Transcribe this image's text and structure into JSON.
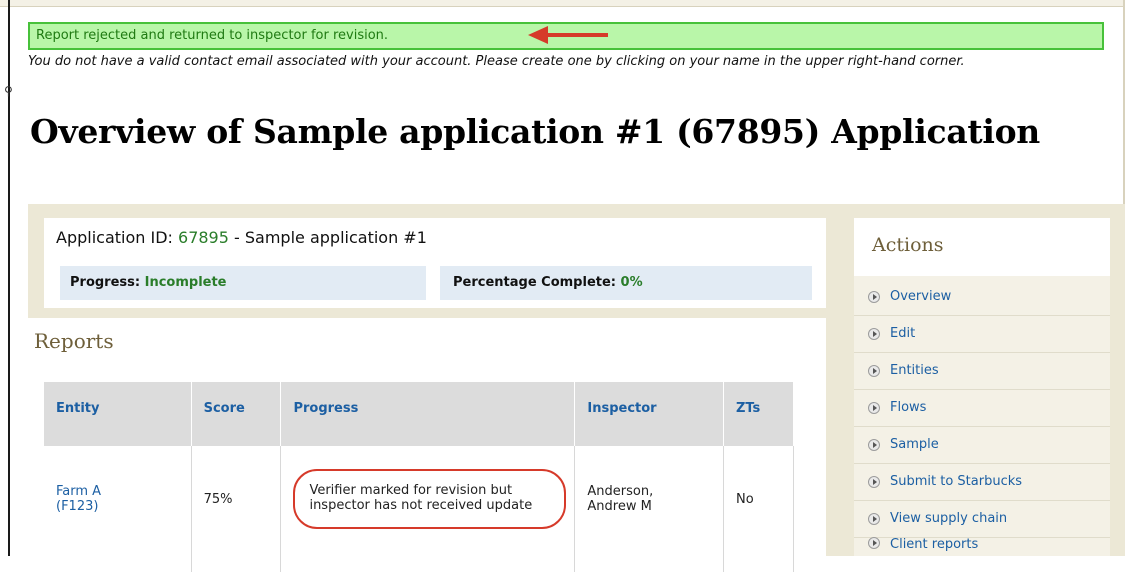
{
  "alert": {
    "message": "Report rejected and returned to inspector for revision."
  },
  "notice": {
    "text": "You do not have a valid contact email associated with your account. Please create one by clicking on your name in the upper right-hand corner."
  },
  "page": {
    "title": "Overview of Sample application #1 (67895) Application"
  },
  "application": {
    "id_label": "Application ID:",
    "id_value": "67895",
    "name": "- Sample application #1",
    "progress_label": "Progress:",
    "progress_value": "Incomplete",
    "percent_label": "Percentage Complete:",
    "percent_value": "0%"
  },
  "reports": {
    "heading": "Reports",
    "columns": [
      "Entity",
      "Score",
      "Progress",
      "Inspector",
      "ZTs"
    ],
    "rows": [
      {
        "entity_name": "Farm A",
        "entity_code": "(F123)",
        "score": "75%",
        "progress": "Verifier marked for revision but inspector has not received update",
        "inspector_last": "Anderson,",
        "inspector_first": "Andrew M",
        "zts": "No"
      }
    ]
  },
  "actions": {
    "title": "Actions",
    "items": [
      "Overview",
      "Edit",
      "Entities",
      "Flows",
      "Sample",
      "Submit to Starbucks",
      "View supply chain",
      "Client reports"
    ]
  },
  "colors": {
    "alert_bg": "#b9f6a9",
    "alert_border": "#47c13a",
    "link": "#1c5fa3",
    "annotation": "#d63a2a"
  }
}
